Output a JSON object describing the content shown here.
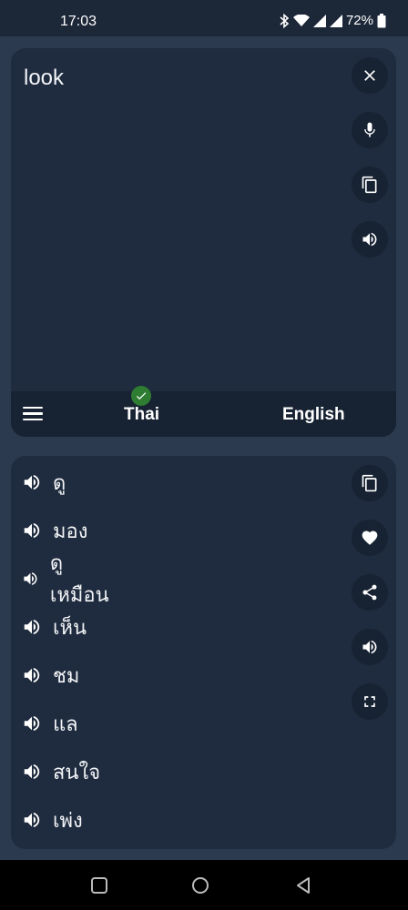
{
  "status": {
    "time": "17:03",
    "battery": "72%"
  },
  "input": {
    "text": "look"
  },
  "languages": {
    "source": "Thai",
    "target": "English"
  },
  "results": [
    {
      "word": "ดู"
    },
    {
      "word": "มอง"
    },
    {
      "word": "ดูเหมือน"
    },
    {
      "word": "เห็น"
    },
    {
      "word": "ชม"
    },
    {
      "word": "แล"
    },
    {
      "word": "สนใจ"
    },
    {
      "word": "เพ่ง"
    }
  ],
  "icons": {
    "input_actions": [
      "close-icon",
      "mic-icon",
      "copy-icon",
      "speaker-icon"
    ],
    "result_actions": [
      "copy-icon",
      "heart-icon",
      "share-icon",
      "speaker-icon",
      "fullscreen-icon"
    ],
    "nav": [
      "recent-apps-icon",
      "home-icon",
      "back-icon"
    ]
  },
  "colors": {
    "background": "#2b3a4e",
    "card": "#1f2b3e",
    "button": "#172232",
    "check": "#2e7d32"
  }
}
